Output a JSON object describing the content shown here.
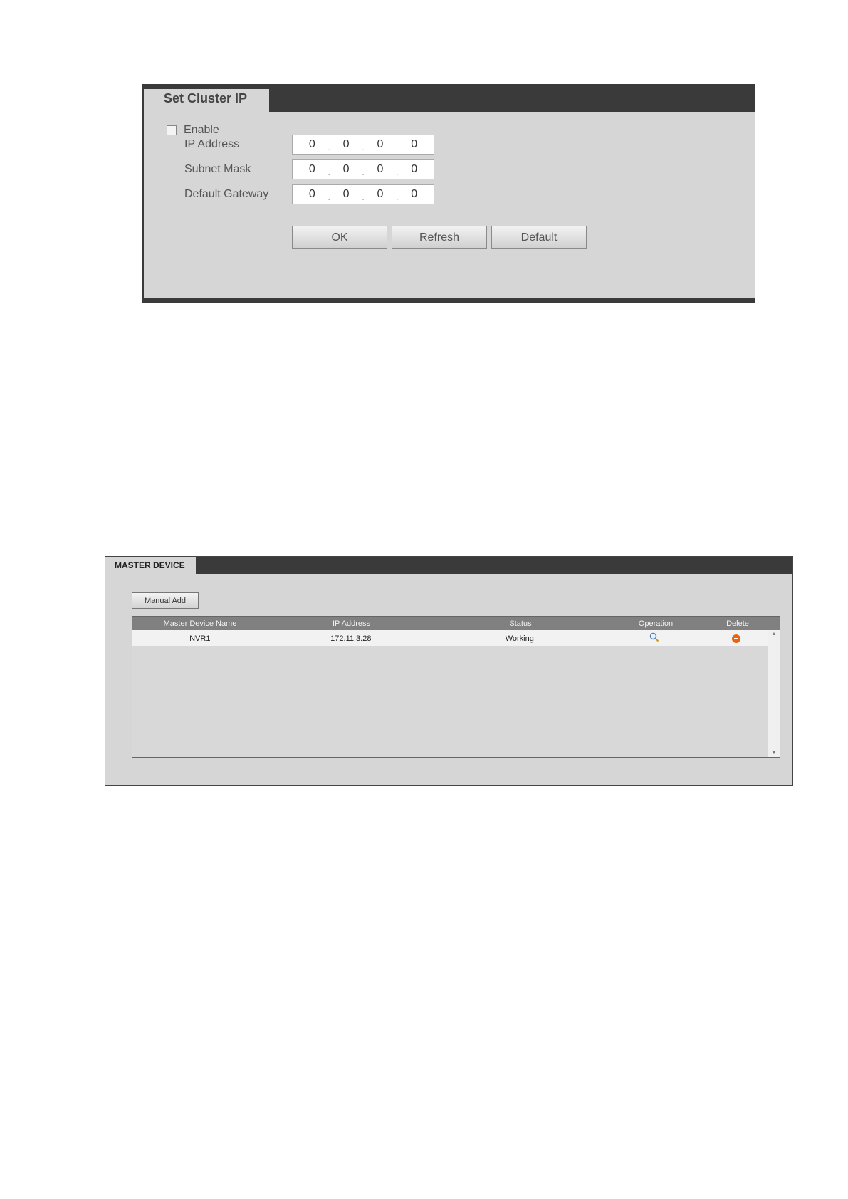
{
  "cluster_panel": {
    "title": "Set Cluster IP",
    "enable_label": "Enable",
    "enable_checked": false,
    "fields": [
      {
        "label": "IP Address",
        "octets": [
          "0",
          "0",
          "0",
          "0"
        ]
      },
      {
        "label": "Subnet Mask",
        "octets": [
          "0",
          "0",
          "0",
          "0"
        ]
      },
      {
        "label": "Default Gateway",
        "octets": [
          "0",
          "0",
          "0",
          "0"
        ]
      }
    ],
    "buttons": {
      "ok": "OK",
      "refresh": "Refresh",
      "default": "Default"
    }
  },
  "master_panel": {
    "title": "MASTER DEVICE",
    "manual_add_label": "Manual Add",
    "columns": [
      "Master Device Name",
      "IP Address",
      "Status",
      "Operation",
      "Delete"
    ],
    "rows": [
      {
        "name": "NVR1",
        "ip": "172.11.3.28",
        "status": "Working",
        "operation_icon": "search-icon",
        "delete_icon": "delete-icon"
      }
    ],
    "colors": {
      "delete_icon": "#e8620f",
      "header_bg": "#808080"
    }
  }
}
